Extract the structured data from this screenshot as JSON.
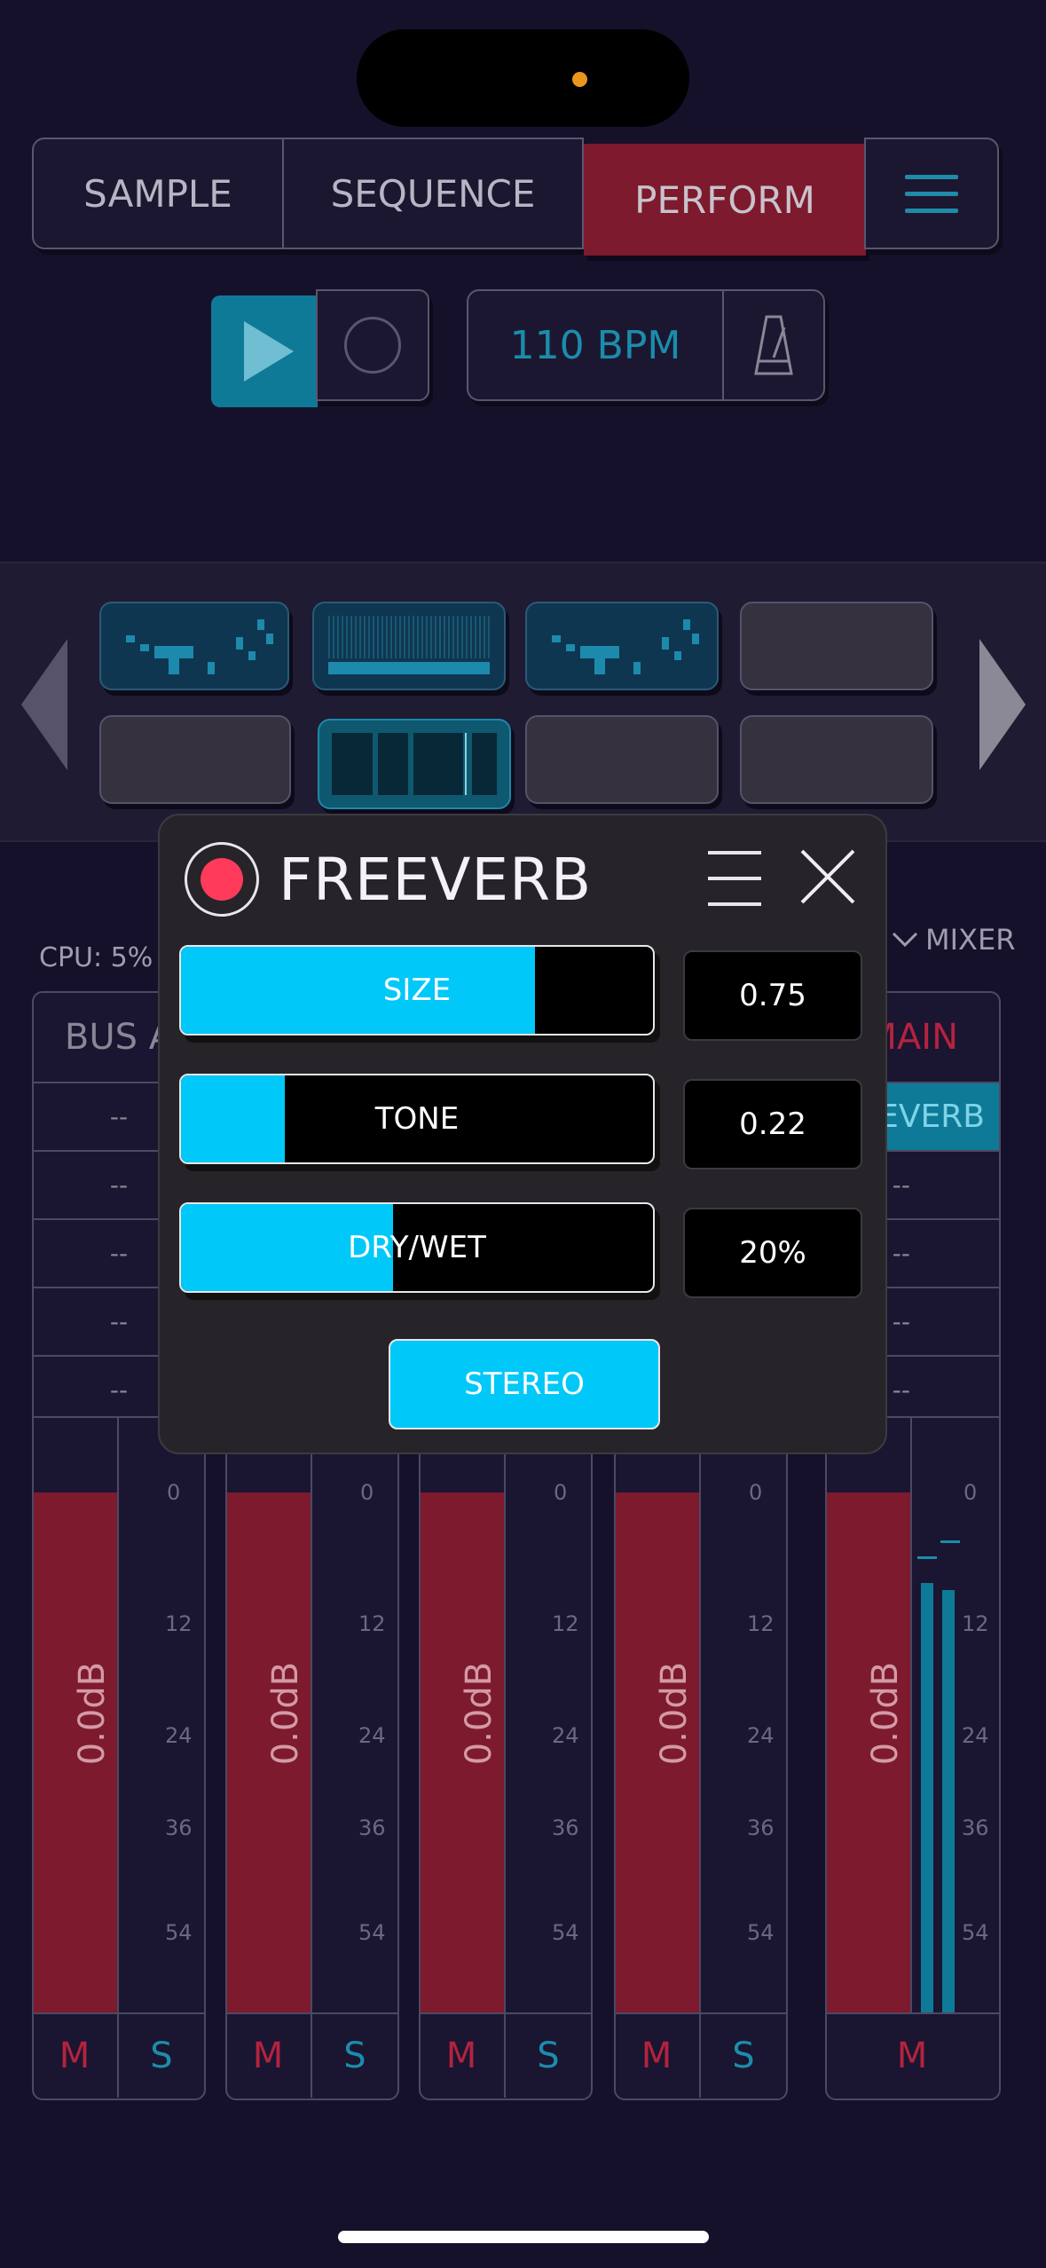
{
  "tabs": [
    {
      "label": "SAMPLE"
    },
    {
      "label": "SEQUENCE"
    },
    {
      "label": "PERFORM",
      "active": true
    }
  ],
  "transport": {
    "tempo": "110 BPM"
  },
  "status": {
    "cpu": "CPU: 5%",
    "mixer_toggle": "MIXER"
  },
  "mixer": {
    "channels": [
      {
        "name": "BUS A",
        "slots": [
          "--",
          "--",
          "--",
          "--",
          "--"
        ],
        "gain": "0.0dB",
        "mute": "M",
        "solo": "S"
      },
      {
        "name": "",
        "slots": [],
        "gain": "0.0dB",
        "mute": "M",
        "solo": "S"
      },
      {
        "name": "",
        "slots": [],
        "gain": "0.0dB",
        "mute": "M",
        "solo": "S"
      },
      {
        "name": "",
        "slots": [],
        "gain": "0.0dB",
        "mute": "M",
        "solo": "S"
      },
      {
        "name": "MAIN",
        "slots": [
          "FREEVERB",
          "--",
          "--",
          "--",
          "--"
        ],
        "gain": "0.0dB",
        "mute": "M"
      }
    ],
    "scale": [
      "0",
      "12",
      "24",
      "36",
      "54"
    ]
  },
  "freeverb": {
    "title": "FREEVERB",
    "params": [
      {
        "label": "SIZE",
        "value": "0.75",
        "level": 0.75
      },
      {
        "label": "TONE",
        "value": "0.22",
        "level": 0.22
      },
      {
        "label": "DRY/WET",
        "value": "20%",
        "level": 0.45
      }
    ],
    "stereo_label": "STEREO"
  },
  "colors": {
    "accent_cyan": "#00c8f8",
    "perform_red": "#7d1a2e",
    "power_red": "#ff3a5a"
  }
}
